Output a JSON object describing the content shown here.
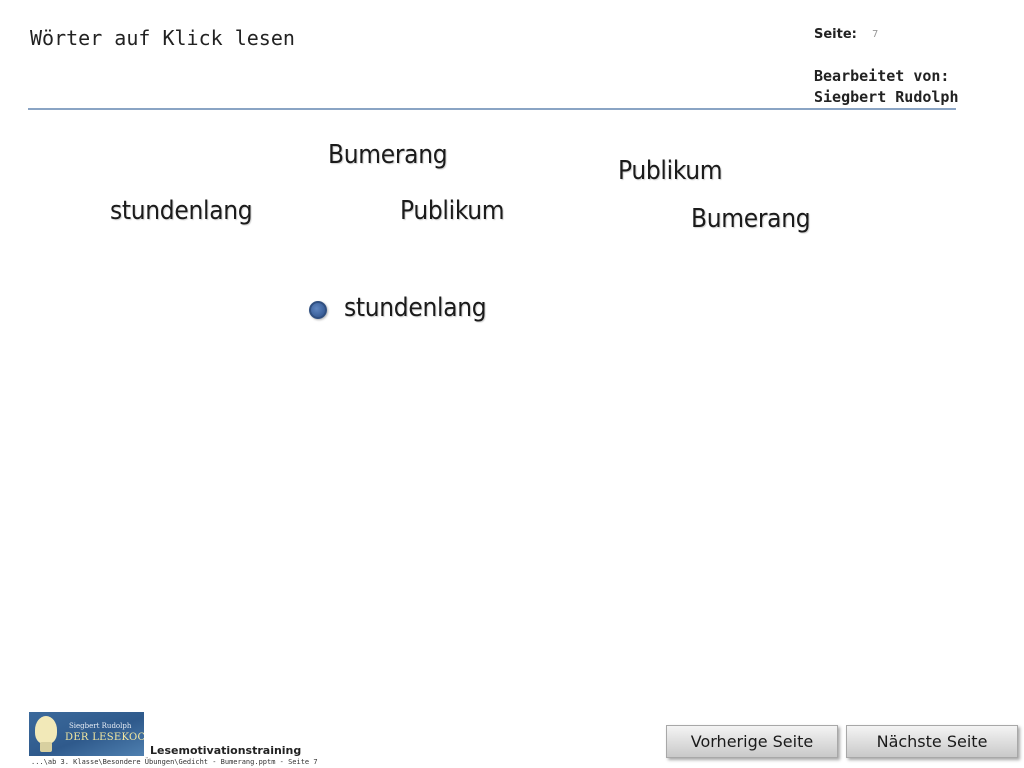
{
  "header": {
    "title": "Wörter auf Klick lesen",
    "page_label": "Seite:",
    "page_number": "7",
    "editor_label": "Bearbeitet von:",
    "editor_name": "Siegbert Rudolph"
  },
  "words": [
    "Bumerang",
    "Publikum",
    "stundenlang",
    "Publikum",
    "Bumerang",
    "stundenlang"
  ],
  "footer": {
    "logo_line1": "Siegbert Rudolph",
    "logo_line2": "DER LESEKOCH",
    "label": "Lesemotivationstraining",
    "path": "...\\ab 3. Klasse\\Besondere Übungen\\Gedicht - Bumerang.pptm - Seite 7"
  },
  "nav": {
    "prev_label": "Vorherige Seite",
    "next_label": "Nächste Seite"
  },
  "colors": {
    "rule": "#8aa4c4",
    "bullet": "#4a72ae",
    "logo_bg": "#3c6a9c"
  }
}
